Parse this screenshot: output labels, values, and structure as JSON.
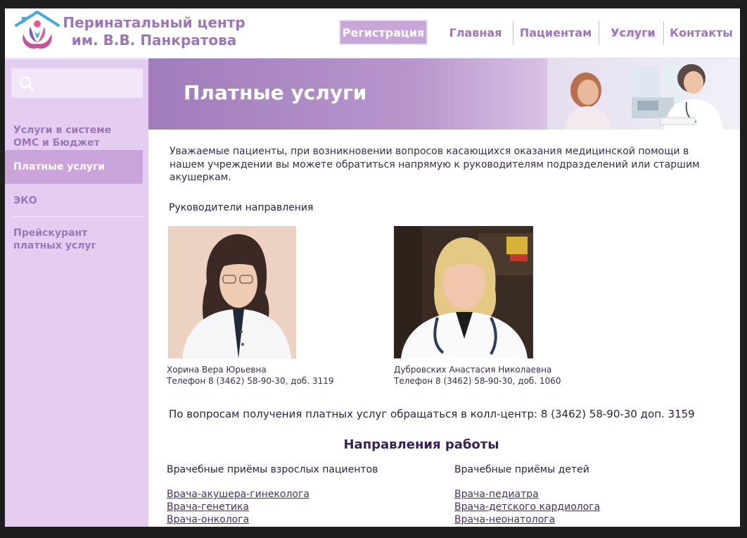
{
  "header": {
    "brand_line1": "Перинатальный центр",
    "brand_line2": "им. В.В. Панкратова",
    "nav": {
      "register": "Регистрация",
      "home": "Главная",
      "patients": "Пациентам",
      "services": "Услуги",
      "contacts": "Контакты"
    }
  },
  "sidebar": {
    "search_placeholder": "",
    "items": [
      {
        "label": "Услуги в системе ОМС и Бюджет"
      },
      {
        "label": "Платные услуги"
      },
      {
        "label": "ЭКО"
      },
      {
        "label": "Прейскурант платных услуг"
      }
    ]
  },
  "banner": {
    "title": "Платные услуги"
  },
  "main": {
    "intro": "Уважаемые пациенты, при возникновении вопросов касающихся оказания медицинской помощи в нашем учреждении вы можете обратиться напрямую к руководителям подразделений или старшим акушеркам.",
    "leaders_title": "Руководители направления",
    "leaders": [
      {
        "name": "Хорина Вера Юрьевна",
        "phone": "Телефон 8 (3462) 58-90-30, доб. 3119"
      },
      {
        "name": "Дубровских Анастасия Николаевна",
        "phone": "Телефон 8 (3462) 58-90-30, доб. 1060"
      }
    ],
    "callcenter": "По вопросам получения платных услуг обращаться в колл-центр: 8 (3462) 58-90-30 доп. 3159",
    "directions_title": "Направления работы",
    "columns": [
      {
        "title": "Врачебные приёмы взрослых пациентов",
        "links": [
          "Врача-акушера-гинеколога",
          "Врача-генетика",
          "Врача-онколога"
        ]
      },
      {
        "title": "Врачебные приёмы детей",
        "links": [
          "Врача-педиатра",
          "Врача-детского кардиолога",
          "Врача-неонатолога"
        ]
      }
    ]
  },
  "colors": {
    "brand": "#9c76b6",
    "sidebar_bg": "#e4cdf1",
    "active_item": "#cba4db",
    "register_bg": "#c7a6d8"
  }
}
